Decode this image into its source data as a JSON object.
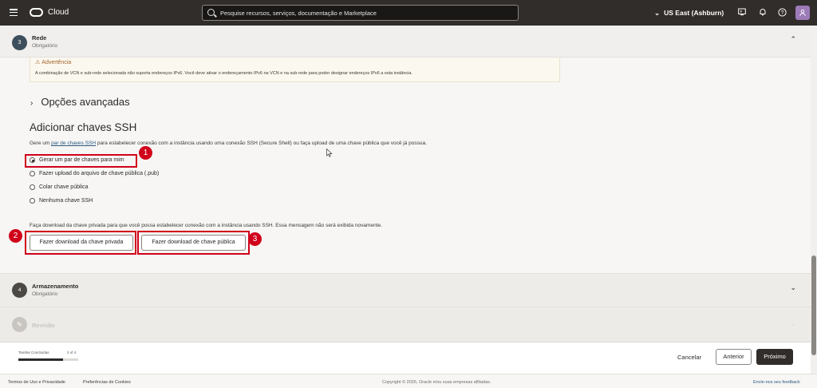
{
  "topbar": {
    "brand": "Cloud",
    "search_placeholder": "Pesquise recursos, serviços, documentação e Marketplace",
    "region": "US East (Ashburn)",
    "region_chevron": "⌄"
  },
  "step3": {
    "number": "3",
    "title": "Rede",
    "subtitle": "Obrigatório",
    "chevron": "⌃"
  },
  "warning": {
    "icon": "⚠",
    "title": "Advertência",
    "text": "A combinação de VCN e sub-rede selecionada não suporta endereços IPv6. Você deve ativar o endereçamento IPv6 na VCN e na sub-rede para poder designar endereços IPv6 a esta instância."
  },
  "advanced": {
    "chevron": "›",
    "label": "Opções avançadas"
  },
  "ssh": {
    "title": "Adicionar chaves SSH",
    "desc_before": "Gere um ",
    "desc_link": "par de chaves SSH",
    "desc_after": " para estabelecer conexão com a instância usando uma conexão SSH (Secure Shell) ou faça upload de uma chave pública que você já possua.",
    "options": [
      {
        "label": "Gerar um par de chaves para mim",
        "selected": true
      },
      {
        "label": "Fazer upload do arquivo de chave pública (.pub)",
        "selected": false
      },
      {
        "label": "Colar chave pública",
        "selected": false
      },
      {
        "label": "Nenhuma chave SSH",
        "selected": false
      }
    ],
    "download_note": "Faça download da chave privada para que você possa estabelecer conexão com a instância usando SSH. Essa mensagem não será exibida novamente.",
    "btn_private": "Fazer download da chave privada",
    "btn_public": "Fazer download de chave pública"
  },
  "annotations": {
    "badge1": "1",
    "badge2": "2",
    "badge3": "3",
    "color": "#d0021b"
  },
  "step4": {
    "number": "4",
    "title": "Armazenamento",
    "subtitle": "Obrigatório",
    "chevron": "⌄"
  },
  "step5": {
    "icon": "✎",
    "title": "Revisão",
    "chevron": "⌄"
  },
  "progress": {
    "label": "Tarefas Concluídas",
    "count": "3 of 4",
    "fraction": 0.75
  },
  "actions": {
    "cancel": "Cancelar",
    "previous": "Anterior",
    "next": "Próximo"
  },
  "footer": {
    "terms": "Termos de Uso e Privacidade",
    "cookies": "Preferências de Cookies",
    "copyright": "Copyright © 2026, Oracle e/ou suas empresas afiliadas.",
    "feedback": "Envie-nos seu feedback"
  },
  "colors": {
    "topbar": "#312d2a",
    "accent_link": "#2a5a82",
    "highlight": "#d0021b"
  }
}
